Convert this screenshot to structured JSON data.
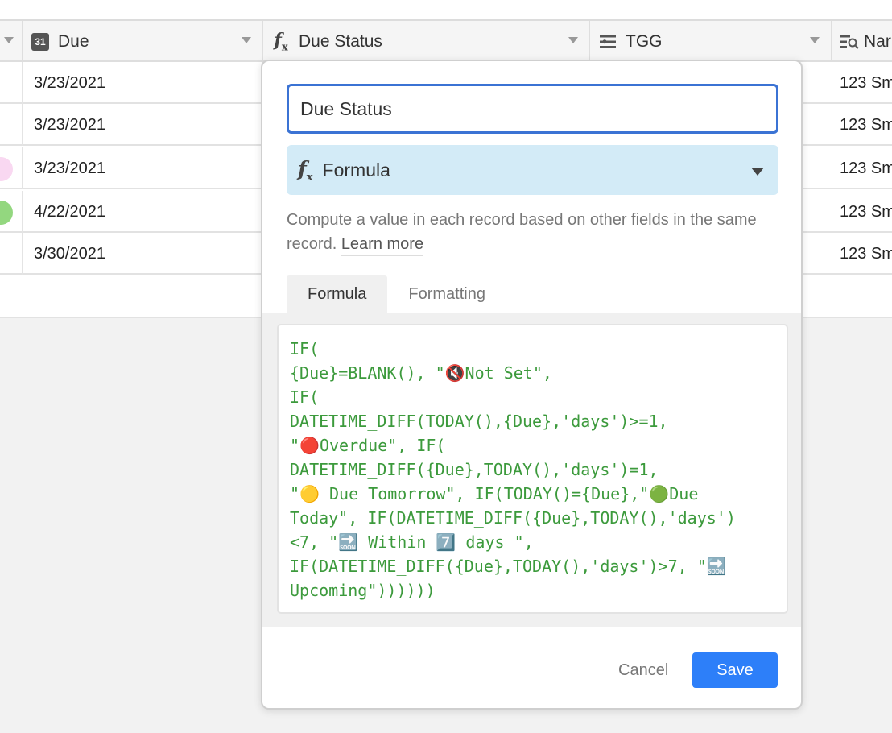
{
  "grid": {
    "columns": [
      {
        "label": "",
        "icon": "none"
      },
      {
        "label": "Due",
        "icon": "calendar-icon",
        "icon_text": "31"
      },
      {
        "label": "Due Status",
        "icon": "formula-icon"
      },
      {
        "label": "TGG",
        "icon": "list-icon"
      },
      {
        "label": "Nar",
        "icon": "lookup-icon"
      }
    ],
    "rows": [
      {
        "due": "3/23/2021",
        "name": "123 Sm",
        "dot": ""
      },
      {
        "due": "3/23/2021",
        "name": "123 Sm",
        "dot": ""
      },
      {
        "due": "3/23/2021",
        "name": "123 Sm",
        "dot": "#f9d8f1"
      },
      {
        "due": "4/22/2021",
        "name": "123 Sm",
        "dot": "#93d77f"
      },
      {
        "due": "3/30/2021",
        "name": "123 Sm",
        "dot": ""
      }
    ]
  },
  "dialog": {
    "field_name": "Due Status",
    "field_type": "Formula",
    "description": "Compute a value in each record based on other fields in the same record.",
    "learn_more": "Learn more",
    "tabs": [
      {
        "label": "Formula",
        "active": true
      },
      {
        "label": "Formatting",
        "active": false
      }
    ],
    "formula": "IF(\n{Due}=BLANK(), \"🔇Not Set\",\nIF(\nDATETIME_DIFF(TODAY(),{Due},'days')>=1,\n\"🔴Overdue\", IF(\nDATETIME_DIFF({Due},TODAY(),'days')=1,\n\"🟡 Due Tomorrow\", IF(TODAY()={Due},\"🟢Due\nToday\", IF(DATETIME_DIFF({Due},TODAY(),'days')\n<7, \"🔜 Within 7️⃣ days \",\nIF(DATETIME_DIFF({Due},TODAY(),'days')>7, \"🔜\nUpcoming\"))))))",
    "cancel_label": "Cancel",
    "save_label": "Save"
  },
  "colors": {
    "accent": "#2d7ff9",
    "input_border": "#3b73d4",
    "type_bg": "#d3ebf7",
    "formula_text": "#3c9a3c"
  }
}
